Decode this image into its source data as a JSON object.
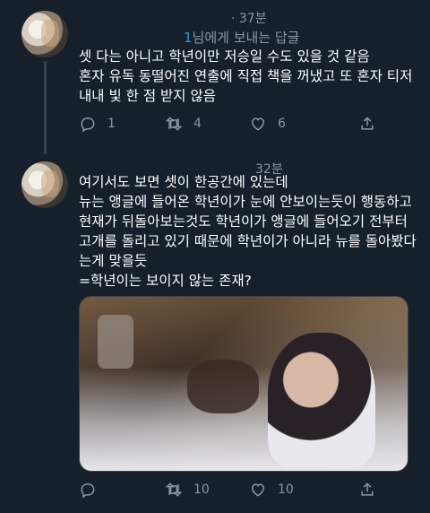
{
  "tweet1": {
    "time": "· 37분",
    "reply_prefix": "",
    "reply_handle": "1",
    "reply_suffix": "님에게 보내는 답글",
    "text": "셋 다는 아니고 학년이만 저승일 수도 있을 것 같음\n혼자 유독 동떨어진 연출에 직접 책을 꺼냈고 또 혼자 티저\n내내 빛 한 점 받지 않음",
    "actions": {
      "reply": "1",
      "retweet": "4",
      "like": "6",
      "share": ""
    }
  },
  "tweet2": {
    "time": "32분",
    "text": "여기서도 보면 셋이 한공간에 있는데\n뉴는 앵글에 들어온 학년이가 눈에 안보이는듯이 행동하고\n현재가 뒤돌아보는것도 학년이가 앵글에 들어오기 전부터\n고개를 돌리고 있기 때문에 학년이가 아니라 뉴를 돌아봤다\n는게 맞을듯\n=학년이는 보이지 않는 존재?",
    "actions": {
      "reply": "",
      "retweet": "10",
      "like": "10",
      "share": ""
    }
  },
  "icons": [
    "reply-icon",
    "retweet-icon",
    "like-icon",
    "share-icon"
  ],
  "colors": {
    "background": "#15202b",
    "muted": "#8899a6",
    "accent": "#1d9bf0"
  }
}
